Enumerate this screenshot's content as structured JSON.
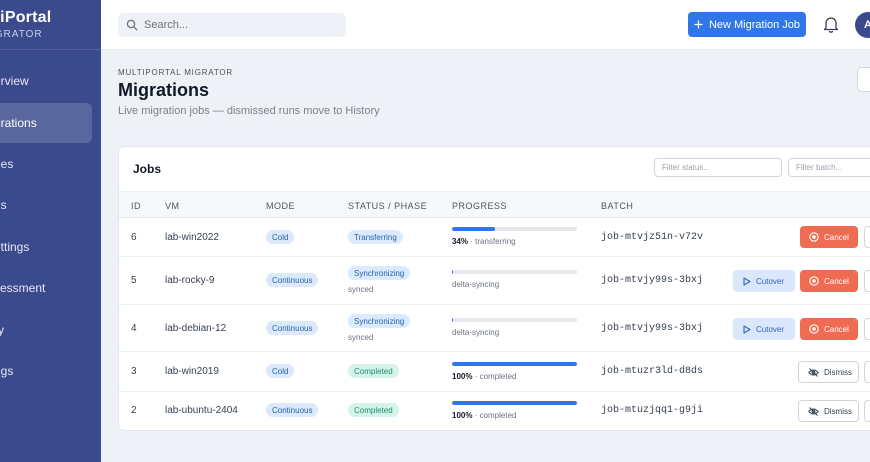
{
  "brand": {
    "title": "ltiPortal",
    "subtitle": "IGRATOR"
  },
  "nav": [
    {
      "label": "erview"
    },
    {
      "label": "grations",
      "active": true
    },
    {
      "label": "des"
    },
    {
      "label": "gs"
    },
    {
      "label": "ettings"
    },
    {
      "label": "sessment"
    },
    {
      "label": "ry"
    },
    {
      "label": "ngs"
    }
  ],
  "topbar": {
    "search_placeholder": "Search...",
    "new_button_label": "New Migration Job",
    "avatar_initial": "A"
  },
  "header": {
    "eyebrow": "MULTIPORTAL MIGRATOR",
    "title": "Migrations",
    "subtitle": "Live migration jobs — dismissed runs move to History"
  },
  "jobs": {
    "title": "Jobs",
    "filter_status_placeholder": "Filter status...",
    "filter_batch_placeholder": "Filter batch...",
    "columns": [
      "ID",
      "VM",
      "MODE",
      "STATUS / PHASE",
      "PROGRESS",
      "BATCH"
    ],
    "rows": [
      {
        "id": "6",
        "vm": "lab-win2022",
        "mode": "Cold",
        "status": "Transferring",
        "phase": "",
        "progress": 0.34,
        "progress_pct": "34%",
        "progress_note": " · transferring",
        "batch": "job-mtvjz51n-v72v",
        "actions": [
          "Cancel"
        ]
      },
      {
        "id": "5",
        "vm": "lab-rocky-9",
        "mode": "Continuous",
        "status": "Synchronizing",
        "phase": "synced",
        "progress": 0.005,
        "progress_pct": "",
        "progress_note": "delta-syncing",
        "batch": "job-mtvjy99s-3bxj",
        "actions": [
          "Cutover",
          "Cancel"
        ]
      },
      {
        "id": "4",
        "vm": "lab-debian-12",
        "mode": "Continuous",
        "status": "Synchronizing",
        "phase": "synced",
        "progress": 0.005,
        "progress_pct": "",
        "progress_note": "delta-syncing",
        "batch": "job-mtvjy99s-3bxj",
        "actions": [
          "Cutover",
          "Cancel"
        ]
      },
      {
        "id": "3",
        "vm": "lab-win2019",
        "mode": "Cold",
        "status": "Completed",
        "phase": "",
        "progress": 1.0,
        "progress_pct": "100%",
        "progress_note": " · completed",
        "batch": "job-mtuzr3ld-d8ds",
        "actions": [
          "Dismiss"
        ]
      },
      {
        "id": "2",
        "vm": "lab-ubuntu-2404",
        "mode": "Continuous",
        "status": "Completed",
        "phase": "",
        "progress": 1.0,
        "progress_pct": "100%",
        "progress_note": " · completed",
        "batch": "job-mtuzjqq1-g9ji",
        "actions": [
          "Dismiss"
        ]
      }
    ]
  },
  "colors": {
    "sidebar": "#3b4a8c",
    "primary": "#2f76e8",
    "cancel": "#ef6b52",
    "completed": "#179272"
  }
}
